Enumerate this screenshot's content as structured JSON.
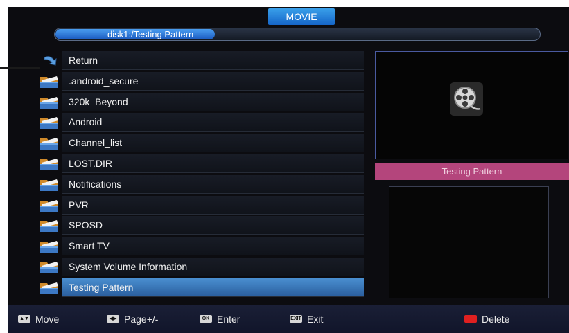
{
  "header": {
    "title": "MOVIE",
    "path": "disk1:/Testing Pattern"
  },
  "file_list": {
    "items": [
      {
        "label": "Return",
        "icon": "return-icon"
      },
      {
        "label": ".android_secure",
        "icon": "folder-icon"
      },
      {
        "label": "320k_Beyond",
        "icon": "folder-icon"
      },
      {
        "label": "Android",
        "icon": "folder-icon"
      },
      {
        "label": "Channel_list",
        "icon": "folder-icon"
      },
      {
        "label": "LOST.DIR",
        "icon": "folder-icon"
      },
      {
        "label": "Notifications",
        "icon": "folder-icon"
      },
      {
        "label": "PVR",
        "icon": "folder-icon"
      },
      {
        "label": "SPOSD",
        "icon": "folder-icon"
      },
      {
        "label": "Smart TV",
        "icon": "folder-icon"
      },
      {
        "label": "System Volume Information",
        "icon": "folder-icon"
      },
      {
        "label": "Testing Pattern",
        "icon": "folder-icon"
      }
    ],
    "selected_label": "Testing Pattern"
  },
  "preview": {
    "icon": "film-reel-icon",
    "name": "Testing Pattern"
  },
  "footer": {
    "move": "Move",
    "page": "Page+/-",
    "enter": "Enter",
    "exit": "Exit",
    "delete": "Delete",
    "ok_key": "OK",
    "exit_key": "EXIT"
  },
  "colors": {
    "title_tab": "#1e7ad8",
    "selected_row": "#3a78bc",
    "name_bar": "#b4457c",
    "footer": "#161b30",
    "delete_key": "#e02020"
  }
}
